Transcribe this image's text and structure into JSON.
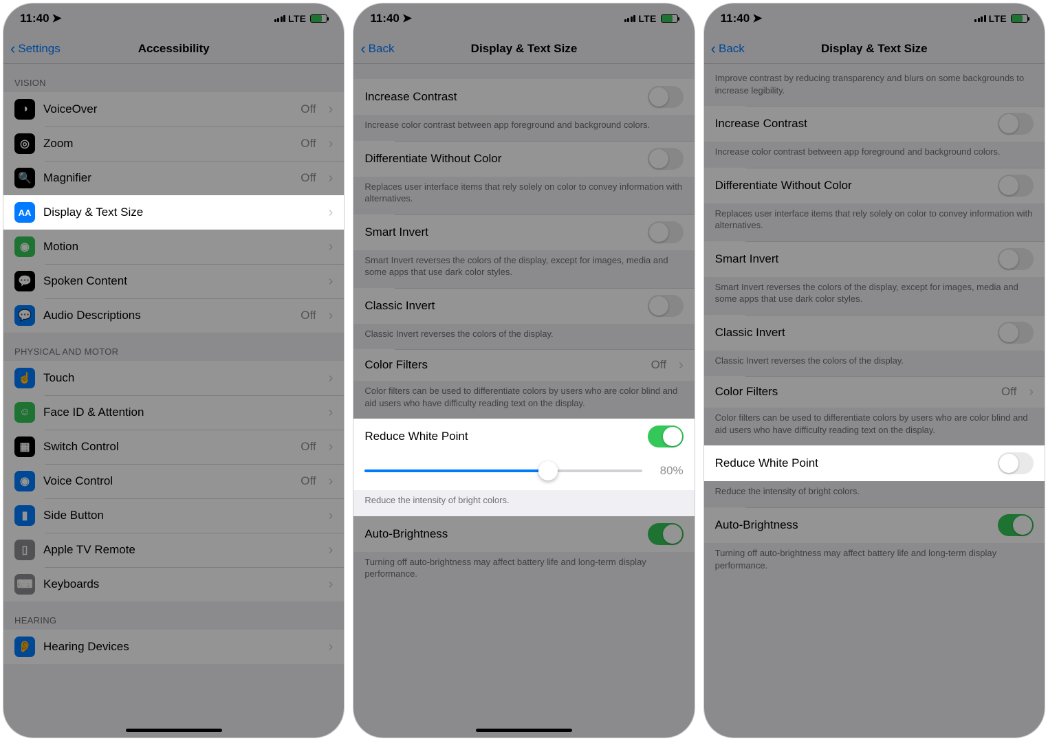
{
  "status": {
    "time": "11:40",
    "carrier": "LTE"
  },
  "screen1": {
    "back": "Settings",
    "title": "Accessibility",
    "sectionVision": "VISION",
    "items": {
      "voiceover": {
        "label": "VoiceOver",
        "value": "Off"
      },
      "zoom": {
        "label": "Zoom",
        "value": "Off"
      },
      "magnifier": {
        "label": "Magnifier",
        "value": "Off"
      },
      "display": {
        "label": "Display & Text Size"
      },
      "motion": {
        "label": "Motion"
      },
      "spoken": {
        "label": "Spoken Content"
      },
      "audiod": {
        "label": "Audio Descriptions",
        "value": "Off"
      }
    },
    "sectionPhysical": "PHYSICAL AND MOTOR",
    "itemsP": {
      "touch": {
        "label": "Touch"
      },
      "faceid": {
        "label": "Face ID & Attention"
      },
      "switch": {
        "label": "Switch Control",
        "value": "Off"
      },
      "voice": {
        "label": "Voice Control",
        "value": "Off"
      },
      "sidebtn": {
        "label": "Side Button"
      },
      "appletv": {
        "label": "Apple TV Remote"
      },
      "keyb": {
        "label": "Keyboards"
      }
    },
    "sectionHearing": "HEARING",
    "itemsH": {
      "hearing": {
        "label": "Hearing Devices"
      }
    }
  },
  "screen2": {
    "back": "Back",
    "title": "Display & Text Size",
    "increase_contrast": {
      "label": "Increase Contrast",
      "desc": "Increase color contrast between app foreground and background colors."
    },
    "diff_color": {
      "label": "Differentiate Without Color",
      "desc": "Replaces user interface items that rely solely on color to convey information with alternatives."
    },
    "smart_invert": {
      "label": "Smart Invert",
      "desc": "Smart Invert reverses the colors of the display, except for images, media and some apps that use dark color styles."
    },
    "classic_invert": {
      "label": "Classic Invert",
      "desc": "Classic Invert reverses the colors of the display."
    },
    "color_filters": {
      "label": "Color Filters",
      "value": "Off",
      "desc": "Color filters can be used to differentiate colors by users who are color blind and aid users who have difficulty reading text on the display."
    },
    "rwp": {
      "label": "Reduce White Point",
      "pct": "80%",
      "on": true,
      "desc": "Reduce the intensity of bright colors."
    },
    "auto_bright": {
      "label": "Auto-Brightness",
      "on": true,
      "desc": "Turning off auto-brightness may affect battery life and long-term display performance."
    }
  },
  "screen3": {
    "back": "Back",
    "title": "Display & Text Size",
    "reduce_trans_desc": "Improve contrast by reducing transparency and blurs on some backgrounds to increase legibility.",
    "increase_contrast": {
      "label": "Increase Contrast",
      "desc": "Increase color contrast between app foreground and background colors."
    },
    "diff_color": {
      "label": "Differentiate Without Color",
      "desc": "Replaces user interface items that rely solely on color to convey information with alternatives."
    },
    "smart_invert": {
      "label": "Smart Invert",
      "desc": "Smart Invert reverses the colors of the display, except for images, media and some apps that use dark color styles."
    },
    "classic_invert": {
      "label": "Classic Invert",
      "desc": "Classic Invert reverses the colors of the display."
    },
    "color_filters": {
      "label": "Color Filters",
      "value": "Off",
      "desc": "Color filters can be used to differentiate colors by users who are color blind and aid users who have difficulty reading text on the display."
    },
    "rwp": {
      "label": "Reduce White Point",
      "on": false,
      "desc": "Reduce the intensity of bright colors."
    },
    "auto_bright": {
      "label": "Auto-Brightness",
      "on": true,
      "desc": "Turning off auto-brightness may affect battery life and long-term display performance."
    }
  }
}
